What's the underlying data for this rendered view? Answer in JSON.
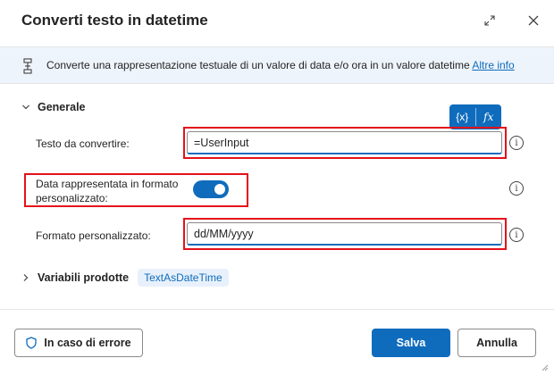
{
  "dialog": {
    "title": "Converti testo in datetime",
    "expand_icon": "expand-icon",
    "close_icon": "close-icon"
  },
  "banner": {
    "icon": "action-icon",
    "text": "Converte una rappresentazione testuale di un valore di data e/o ora in un valore datetime",
    "link": "Altre info"
  },
  "section": {
    "title": "Generale",
    "var_button": "{x}",
    "fx_button": "fx"
  },
  "fields": {
    "text_label": "Testo da convertire:",
    "text_value": "=UserInput",
    "custom_format_toggle_label_line1": "Data rappresentata in formato",
    "custom_format_toggle_label_line2": "personalizzato:",
    "custom_format_toggle_on": true,
    "format_label": "Formato personalizzato:",
    "format_value": "dd/MM/yyyy",
    "info_glyph": "i"
  },
  "variables": {
    "title": "Variabili prodotte",
    "chip": "TextAsDateTime"
  },
  "footer": {
    "error_button": "In caso di errore",
    "save_button": "Salva",
    "cancel_button": "Annulla"
  },
  "colors": {
    "accent": "#0f6cbd",
    "highlight": "#e3111a",
    "banner_bg": "#eef4fb"
  }
}
